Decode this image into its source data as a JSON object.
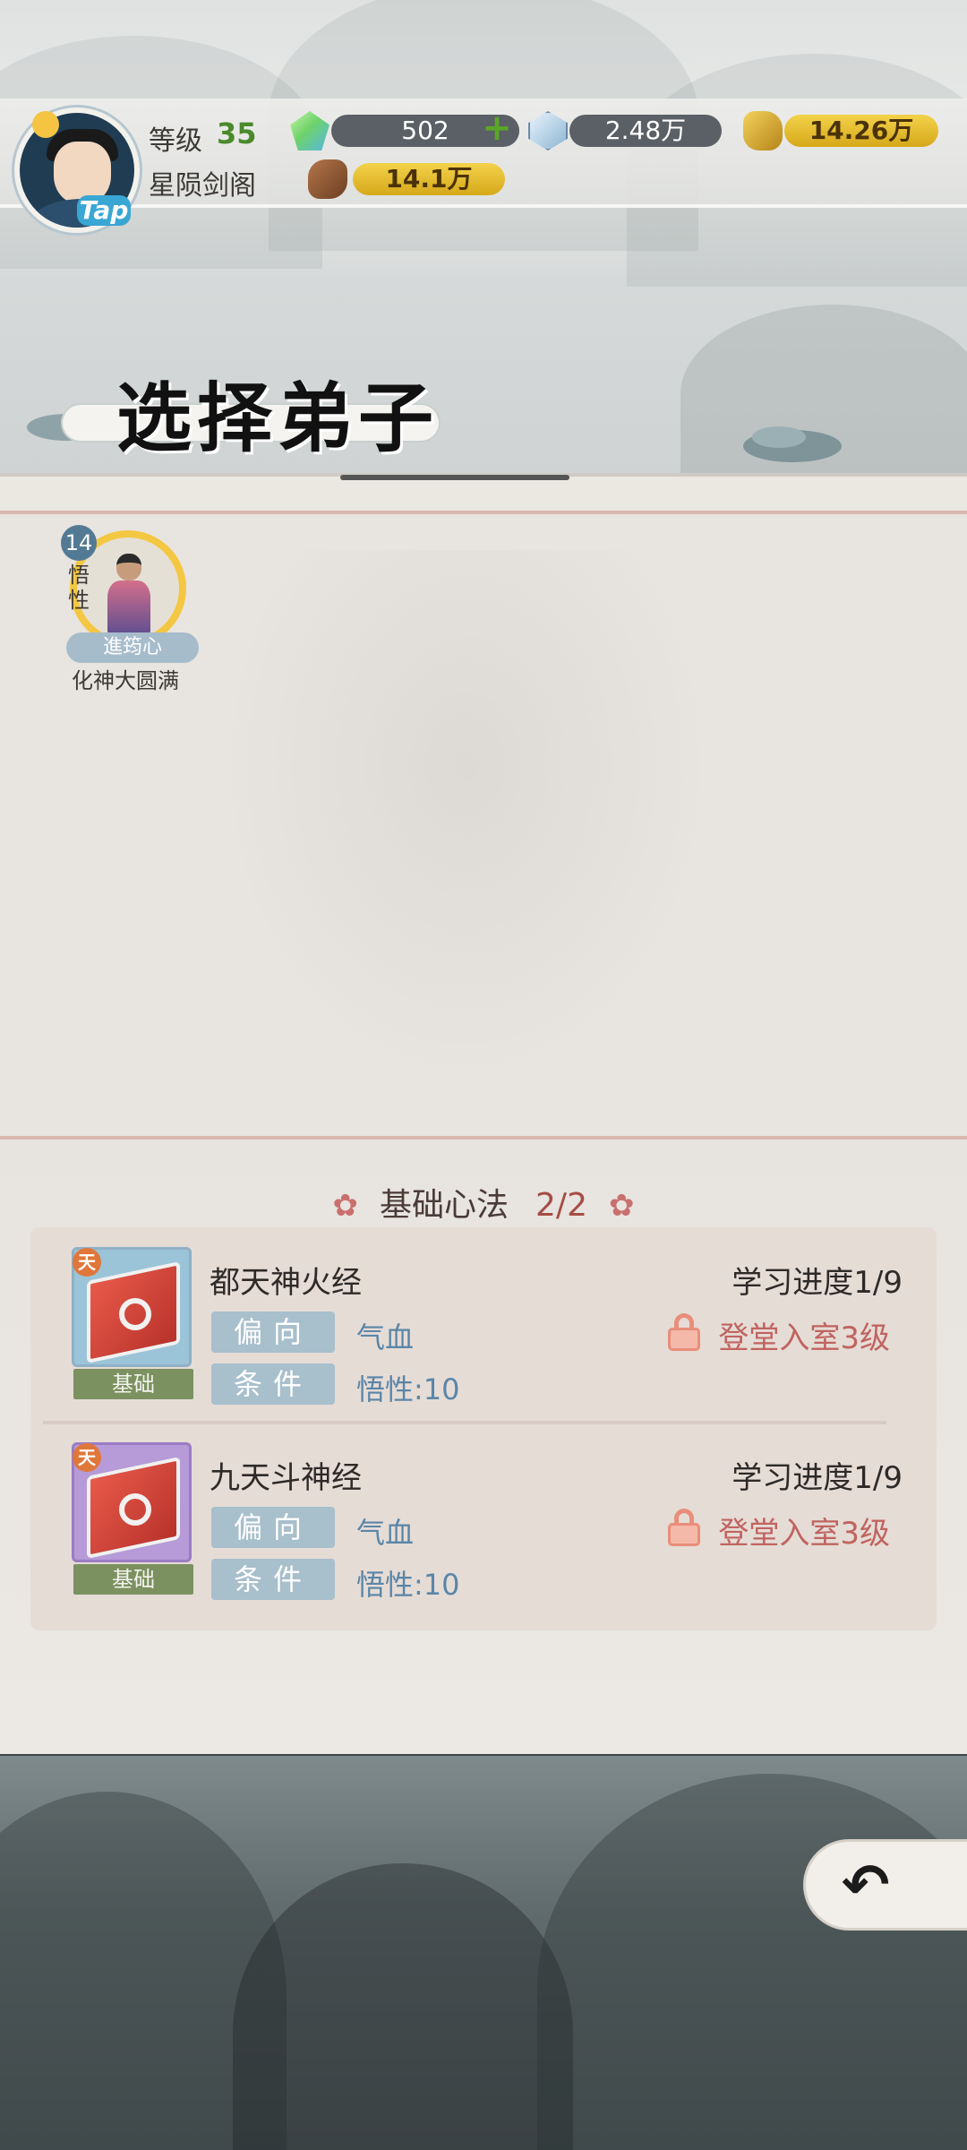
{
  "header": {
    "avatar_badge": "Tap",
    "level_label": "等级",
    "level_value": "35",
    "sect_name": "星陨剑阁",
    "resources": {
      "spirit_gem": "502",
      "crystal": "2.48万",
      "gold_ore": "14.26万",
      "wood": "14.1万"
    }
  },
  "page": {
    "title": "选择弟子"
  },
  "disciples": [
    {
      "level": "14",
      "trait": "悟性",
      "name": "進筠心",
      "realm": "化神大圆满"
    }
  ],
  "section": {
    "title": "基础心法",
    "count": "2/2"
  },
  "skills": [
    {
      "grade_badge": "天",
      "name": "都天神火经",
      "category": "基础",
      "tendency_label": "偏向",
      "tendency_value": "气血",
      "condition_label": "条件",
      "condition_value": "悟性:10",
      "progress": "学习进度1/9",
      "lock_text": "登堂入室3级"
    },
    {
      "grade_badge": "天",
      "name": "九天斗神经",
      "category": "基础",
      "tendency_label": "偏向",
      "tendency_value": "气血",
      "condition_label": "条件",
      "condition_value": "悟性:10",
      "progress": "学习进度1/9",
      "lock_text": "登堂入室3级"
    }
  ],
  "icons": {
    "flower": "✿",
    "back": "↶"
  },
  "colors": {
    "accent_gold": "#f4c743",
    "level_green": "#4a8a2a",
    "lock_red": "#c06460",
    "tag_blue": "#a8bfcc",
    "base_tag_green": "#7b9160"
  }
}
